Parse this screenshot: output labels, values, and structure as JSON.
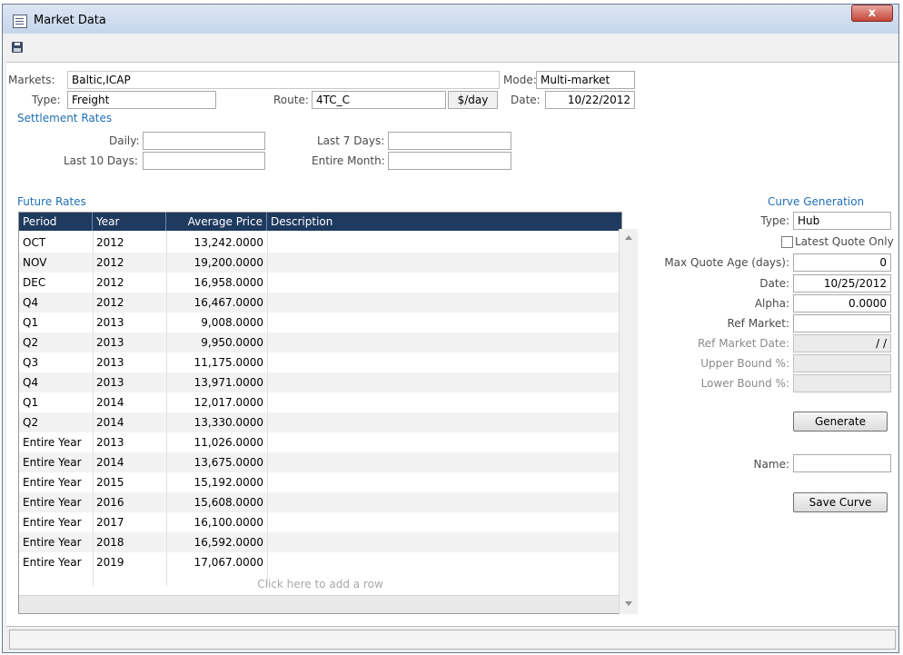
{
  "window": {
    "title": "Market Data",
    "close_glyph": "x"
  },
  "toolbar": {
    "save_icon": "save-icon"
  },
  "header": {
    "markets_label": "Markets:",
    "markets_value": "Baltic,ICAP",
    "mode_label": "Mode:",
    "mode_value": "Multi-market",
    "type_label": "Type:",
    "type_value": "Freight",
    "route_label": "Route:",
    "route_value": "4TC_C",
    "unit": "$/day",
    "date_label": "Date:",
    "date_value": "10/22/2012"
  },
  "settlement": {
    "title": "Settlement Rates",
    "daily_label": "Daily:",
    "last7_label": "Last 7 Days:",
    "last10_label": "Last 10 Days:",
    "month_label": "Entire Month:"
  },
  "future": {
    "title": "Future Rates",
    "columns": [
      "Period",
      "Year",
      "Average Price",
      "Description"
    ],
    "rows": [
      {
        "period": "OCT",
        "year": "2012",
        "price": "13,242.0000"
      },
      {
        "period": "NOV",
        "year": "2012",
        "price": "19,200.0000"
      },
      {
        "period": "DEC",
        "year": "2012",
        "price": "16,958.0000"
      },
      {
        "period": "Q4",
        "year": "2012",
        "price": "16,467.0000"
      },
      {
        "period": "Q1",
        "year": "2013",
        "price": "9,008.0000"
      },
      {
        "period": "Q2",
        "year": "2013",
        "price": "9,950.0000"
      },
      {
        "period": "Q3",
        "year": "2013",
        "price": "11,175.0000"
      },
      {
        "period": "Q4",
        "year": "2013",
        "price": "13,971.0000"
      },
      {
        "period": "Q1",
        "year": "2014",
        "price": "12,017.0000"
      },
      {
        "period": "Q2",
        "year": "2014",
        "price": "13,330.0000"
      },
      {
        "period": "Entire Year",
        "year": "2013",
        "price": "11,026.0000"
      },
      {
        "period": "Entire Year",
        "year": "2014",
        "price": "13,675.0000"
      },
      {
        "period": "Entire Year",
        "year": "2015",
        "price": "15,192.0000"
      },
      {
        "period": "Entire Year",
        "year": "2016",
        "price": "15,608.0000"
      },
      {
        "period": "Entire Year",
        "year": "2017",
        "price": "16,100.0000"
      },
      {
        "period": "Entire Year",
        "year": "2018",
        "price": "16,592.0000"
      },
      {
        "period": "Entire Year",
        "year": "2019",
        "price": "17,067.0000"
      }
    ],
    "add_row": "Click here to add a row"
  },
  "curve": {
    "title": "Curve Generation",
    "type_label": "Type:",
    "type_value": "Hub",
    "latest_quote_label": "Latest Quote Only",
    "max_age_label": "Max Quote Age (days):",
    "max_age_value": "0",
    "date_label": "Date:",
    "date_value": "10/25/2012",
    "alpha_label": "Alpha:",
    "alpha_value": "0.0000",
    "ref_market_label": "Ref Market:",
    "ref_market_date_label": "Ref Market Date:",
    "ref_market_date_value": "/ /",
    "upper_label": "Upper Bound %:",
    "lower_label": "Lower Bound %:",
    "generate_label": "Generate",
    "name_label": "Name:",
    "save_curve_label": "Save Curve"
  }
}
